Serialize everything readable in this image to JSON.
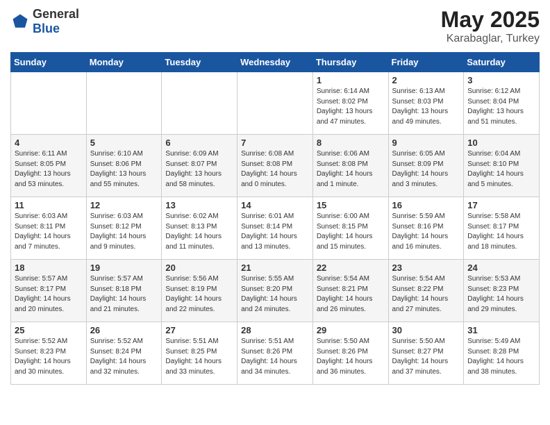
{
  "header": {
    "logo_general": "General",
    "logo_blue": "Blue",
    "title": "May 2025",
    "location": "Karabaglar, Turkey"
  },
  "weekdays": [
    "Sunday",
    "Monday",
    "Tuesday",
    "Wednesday",
    "Thursday",
    "Friday",
    "Saturday"
  ],
  "weeks": [
    [
      {
        "day": "",
        "info": ""
      },
      {
        "day": "",
        "info": ""
      },
      {
        "day": "",
        "info": ""
      },
      {
        "day": "",
        "info": ""
      },
      {
        "day": "1",
        "info": "Sunrise: 6:14 AM\nSunset: 8:02 PM\nDaylight: 13 hours\nand 47 minutes."
      },
      {
        "day": "2",
        "info": "Sunrise: 6:13 AM\nSunset: 8:03 PM\nDaylight: 13 hours\nand 49 minutes."
      },
      {
        "day": "3",
        "info": "Sunrise: 6:12 AM\nSunset: 8:04 PM\nDaylight: 13 hours\nand 51 minutes."
      }
    ],
    [
      {
        "day": "4",
        "info": "Sunrise: 6:11 AM\nSunset: 8:05 PM\nDaylight: 13 hours\nand 53 minutes."
      },
      {
        "day": "5",
        "info": "Sunrise: 6:10 AM\nSunset: 8:06 PM\nDaylight: 13 hours\nand 55 minutes."
      },
      {
        "day": "6",
        "info": "Sunrise: 6:09 AM\nSunset: 8:07 PM\nDaylight: 13 hours\nand 58 minutes."
      },
      {
        "day": "7",
        "info": "Sunrise: 6:08 AM\nSunset: 8:08 PM\nDaylight: 14 hours\nand 0 minutes."
      },
      {
        "day": "8",
        "info": "Sunrise: 6:06 AM\nSunset: 8:08 PM\nDaylight: 14 hours\nand 1 minute."
      },
      {
        "day": "9",
        "info": "Sunrise: 6:05 AM\nSunset: 8:09 PM\nDaylight: 14 hours\nand 3 minutes."
      },
      {
        "day": "10",
        "info": "Sunrise: 6:04 AM\nSunset: 8:10 PM\nDaylight: 14 hours\nand 5 minutes."
      }
    ],
    [
      {
        "day": "11",
        "info": "Sunrise: 6:03 AM\nSunset: 8:11 PM\nDaylight: 14 hours\nand 7 minutes."
      },
      {
        "day": "12",
        "info": "Sunrise: 6:03 AM\nSunset: 8:12 PM\nDaylight: 14 hours\nand 9 minutes."
      },
      {
        "day": "13",
        "info": "Sunrise: 6:02 AM\nSunset: 8:13 PM\nDaylight: 14 hours\nand 11 minutes."
      },
      {
        "day": "14",
        "info": "Sunrise: 6:01 AM\nSunset: 8:14 PM\nDaylight: 14 hours\nand 13 minutes."
      },
      {
        "day": "15",
        "info": "Sunrise: 6:00 AM\nSunset: 8:15 PM\nDaylight: 14 hours\nand 15 minutes."
      },
      {
        "day": "16",
        "info": "Sunrise: 5:59 AM\nSunset: 8:16 PM\nDaylight: 14 hours\nand 16 minutes."
      },
      {
        "day": "17",
        "info": "Sunrise: 5:58 AM\nSunset: 8:17 PM\nDaylight: 14 hours\nand 18 minutes."
      }
    ],
    [
      {
        "day": "18",
        "info": "Sunrise: 5:57 AM\nSunset: 8:17 PM\nDaylight: 14 hours\nand 20 minutes."
      },
      {
        "day": "19",
        "info": "Sunrise: 5:57 AM\nSunset: 8:18 PM\nDaylight: 14 hours\nand 21 minutes."
      },
      {
        "day": "20",
        "info": "Sunrise: 5:56 AM\nSunset: 8:19 PM\nDaylight: 14 hours\nand 22 minutes."
      },
      {
        "day": "21",
        "info": "Sunrise: 5:55 AM\nSunset: 8:20 PM\nDaylight: 14 hours\nand 24 minutes."
      },
      {
        "day": "22",
        "info": "Sunrise: 5:54 AM\nSunset: 8:21 PM\nDaylight: 14 hours\nand 26 minutes."
      },
      {
        "day": "23",
        "info": "Sunrise: 5:54 AM\nSunset: 8:22 PM\nDaylight: 14 hours\nand 27 minutes."
      },
      {
        "day": "24",
        "info": "Sunrise: 5:53 AM\nSunset: 8:23 PM\nDaylight: 14 hours\nand 29 minutes."
      }
    ],
    [
      {
        "day": "25",
        "info": "Sunrise: 5:52 AM\nSunset: 8:23 PM\nDaylight: 14 hours\nand 30 minutes."
      },
      {
        "day": "26",
        "info": "Sunrise: 5:52 AM\nSunset: 8:24 PM\nDaylight: 14 hours\nand 32 minutes."
      },
      {
        "day": "27",
        "info": "Sunrise: 5:51 AM\nSunset: 8:25 PM\nDaylight: 14 hours\nand 33 minutes."
      },
      {
        "day": "28",
        "info": "Sunrise: 5:51 AM\nSunset: 8:26 PM\nDaylight: 14 hours\nand 34 minutes."
      },
      {
        "day": "29",
        "info": "Sunrise: 5:50 AM\nSunset: 8:26 PM\nDaylight: 14 hours\nand 36 minutes."
      },
      {
        "day": "30",
        "info": "Sunrise: 5:50 AM\nSunset: 8:27 PM\nDaylight: 14 hours\nand 37 minutes."
      },
      {
        "day": "31",
        "info": "Sunrise: 5:49 AM\nSunset: 8:28 PM\nDaylight: 14 hours\nand 38 minutes."
      }
    ]
  ]
}
